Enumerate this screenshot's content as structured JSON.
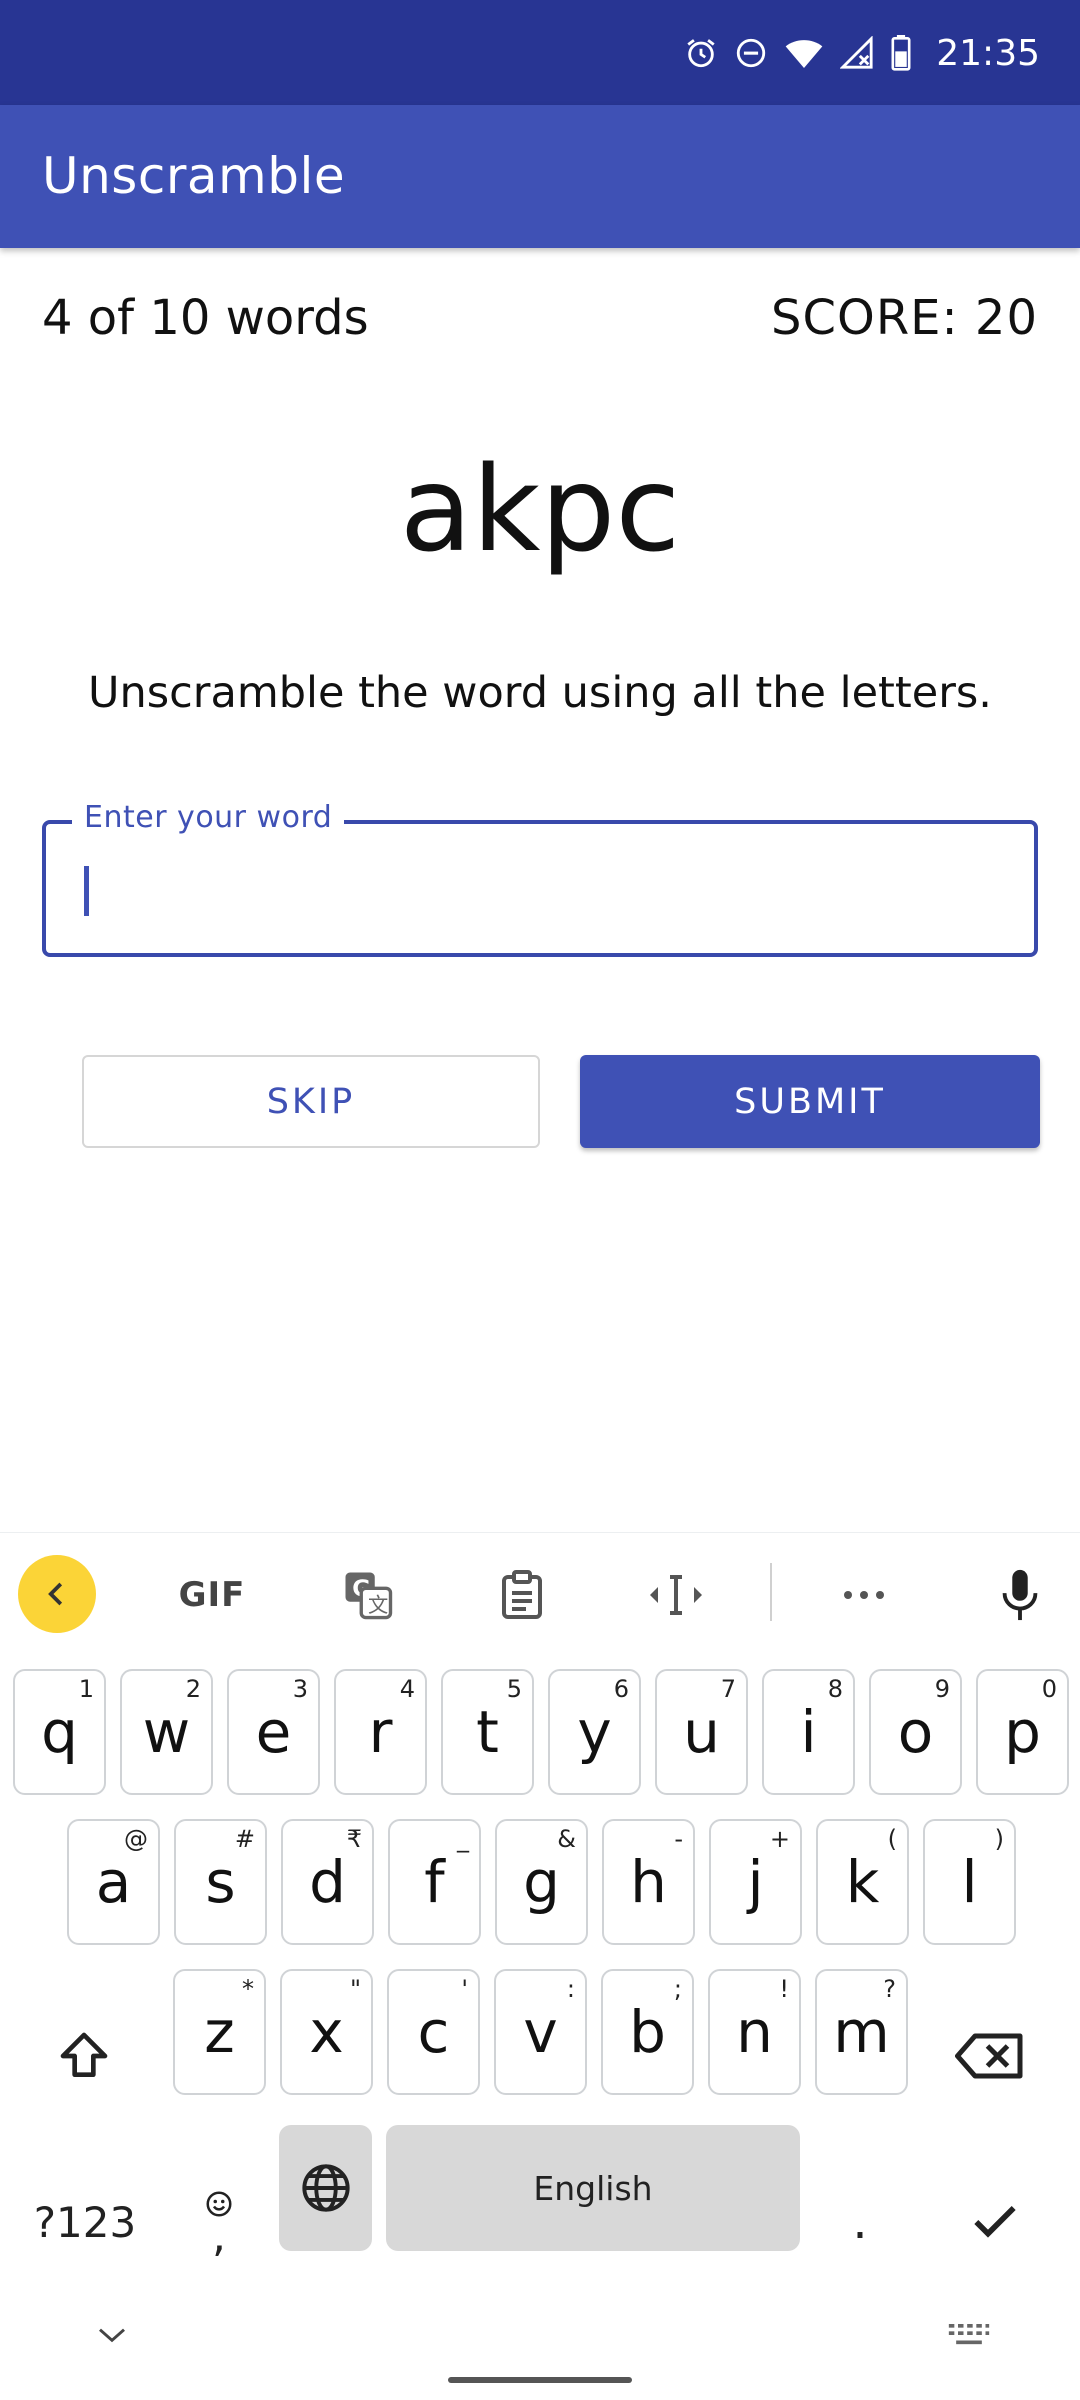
{
  "status_bar": {
    "time": "21:35",
    "icons": [
      "alarm-icon",
      "do-not-disturb-icon",
      "wifi-icon",
      "cell-signal-icon",
      "battery-icon"
    ]
  },
  "app_bar": {
    "title": "Unscramble"
  },
  "game": {
    "word_count": "4 of 10 words",
    "score": "SCORE: 20",
    "scrambled_word": "akpc",
    "instructions": "Unscramble the word using all the letters.",
    "input": {
      "label": "Enter your word",
      "value": ""
    },
    "skip_label": "SKIP",
    "submit_label": "SUBMIT"
  },
  "keyboard": {
    "toolbar": {
      "gif_label": "GIF"
    },
    "row1": [
      {
        "k": "q",
        "h": "1"
      },
      {
        "k": "w",
        "h": "2"
      },
      {
        "k": "e",
        "h": "3"
      },
      {
        "k": "r",
        "h": "4"
      },
      {
        "k": "t",
        "h": "5"
      },
      {
        "k": "y",
        "h": "6"
      },
      {
        "k": "u",
        "h": "7"
      },
      {
        "k": "i",
        "h": "8"
      },
      {
        "k": "o",
        "h": "9"
      },
      {
        "k": "p",
        "h": "0"
      }
    ],
    "row2": [
      {
        "k": "a",
        "h": "@"
      },
      {
        "k": "s",
        "h": "#"
      },
      {
        "k": "d",
        "h": "₹"
      },
      {
        "k": "f",
        "h": "_"
      },
      {
        "k": "g",
        "h": "&"
      },
      {
        "k": "h",
        "h": "-"
      },
      {
        "k": "j",
        "h": "+"
      },
      {
        "k": "k",
        "h": "("
      },
      {
        "k": "l",
        "h": ")"
      }
    ],
    "row3": [
      {
        "k": "z",
        "h": "*"
      },
      {
        "k": "x",
        "h": "\""
      },
      {
        "k": "c",
        "h": "'"
      },
      {
        "k": "v",
        "h": ":"
      },
      {
        "k": "b",
        "h": ";"
      },
      {
        "k": "n",
        "h": "!"
      },
      {
        "k": "m",
        "h": "?"
      }
    ],
    "symbols_label": "?123",
    "comma_label": ",",
    "space_label": "English",
    "period_label": "."
  },
  "colors": {
    "status_bar": "#283593",
    "app_bar": "#3f51b5",
    "accent": "#3f51b5",
    "keyboard_back_button": "#fbd437"
  }
}
